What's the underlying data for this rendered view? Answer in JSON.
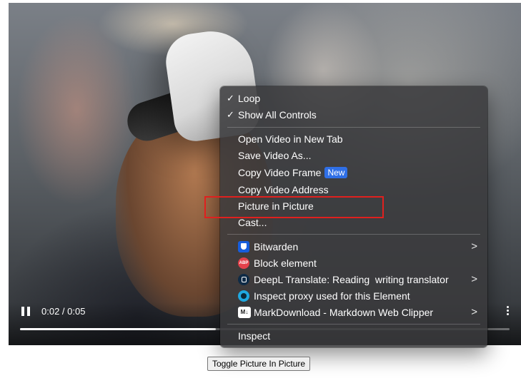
{
  "video": {
    "time_display": "0:02 / 0:05",
    "progress_fraction": 0.4,
    "icons": {
      "pause": "pause-icon",
      "more": "more-vertical-icon"
    }
  },
  "context_menu": {
    "checked_items": [
      {
        "label": "Loop",
        "check": "✓"
      },
      {
        "label": "Show All Controls",
        "check": "✓"
      }
    ],
    "video_items": [
      {
        "label": "Open Video in New Tab"
      },
      {
        "label": "Save Video As..."
      },
      {
        "label": "Copy Video Frame",
        "badge": "New"
      },
      {
        "label": "Copy Video Address"
      },
      {
        "label": "Picture in Picture",
        "highlighted": true
      },
      {
        "label": "Cast..."
      }
    ],
    "extension_items": [
      {
        "label": "Bitwarden",
        "icon": "bitwarden-icon",
        "submenu": ">"
      },
      {
        "label": "Block element",
        "icon": "adblock-plus-icon",
        "icon_text": "ABP"
      },
      {
        "label": "DeepL Translate: Reading  writing translator",
        "icon": "deepl-icon",
        "submenu": ">"
      },
      {
        "label": "Inspect proxy used for this Element",
        "icon": "proxy-icon"
      },
      {
        "label": "MarkDownload - Markdown Web Clipper",
        "icon": "markdown-icon",
        "icon_text": "M↓",
        "submenu": ">"
      }
    ],
    "inspect": {
      "label": "Inspect"
    }
  },
  "highlight_color": "#e0201e",
  "toggle_button": {
    "label": "Toggle Picture In Picture"
  }
}
